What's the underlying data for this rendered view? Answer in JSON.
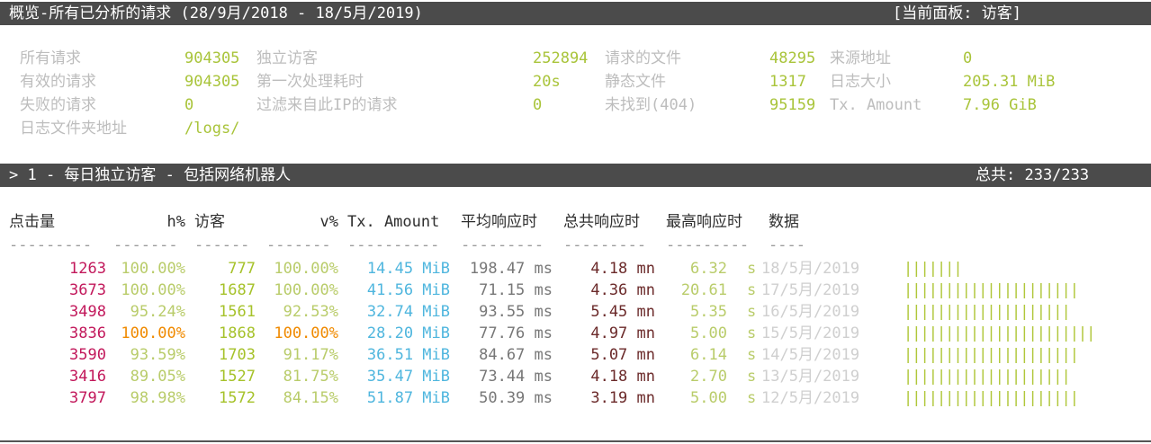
{
  "header": {
    "title": "概览-所有已分析的请求 (28/9月/2018 - 18/5月/2019)",
    "panel_label": "[当前面板: 访客]"
  },
  "overview": {
    "col1": [
      {
        "label": "所有请求",
        "value": "904305"
      },
      {
        "label": "有效的请求",
        "value": "904305"
      },
      {
        "label": "失败的请求",
        "value": "0"
      },
      {
        "label": "日志文件夹地址",
        "value": "/logs/"
      }
    ],
    "col2": [
      {
        "label": "独立访客",
        "value": "252894"
      },
      {
        "label": "第一次处理耗时",
        "value": "20s"
      },
      {
        "label": "过滤来自此IP的请求",
        "value": "0"
      }
    ],
    "col3": [
      {
        "label": "请求的文件",
        "value": "48295"
      },
      {
        "label": "静态文件",
        "value": "1317"
      },
      {
        "label": "未找到(404)",
        "value": "95159"
      }
    ],
    "col4": [
      {
        "label": "来源地址",
        "value": "0"
      },
      {
        "label": "日志大小",
        "value": "205.31 MiB"
      },
      {
        "label": "Tx. Amount",
        "value": "7.96 GiB"
      }
    ]
  },
  "panel": {
    "title": "> 1 - 每日独立访客 - 包括网络机器人",
    "total": "总共: 233/233"
  },
  "table": {
    "columns": [
      "点击量",
      "h%",
      "访客",
      "v%",
      "Tx. Amount",
      "平均响应时",
      "总共响应时",
      "最高响应时",
      "数据"
    ],
    "dashes": [
      "---------",
      "-------",
      "------",
      "-------",
      "----------",
      "---------",
      "---------",
      "---------",
      "----"
    ],
    "rows": [
      {
        "hits": "1263",
        "hp": "100.00%",
        "visitors": "777",
        "vp": "100.00%",
        "tx": "14.45 MiB",
        "avg": "198.47 ms",
        "cum": "4.18 mn",
        "max": "6.32",
        "maxu": "s",
        "date": "18/5月/2019",
        "bars": 7,
        "highlight": false
      },
      {
        "hits": "3673",
        "hp": "100.00%",
        "visitors": "1687",
        "vp": "100.00%",
        "tx": "41.56 MiB",
        "avg": "71.15 ms",
        "cum": "4.36 mn",
        "max": "20.61",
        "maxu": "s",
        "date": "17/5月/2019",
        "bars": 21,
        "highlight": false
      },
      {
        "hits": "3498",
        "hp": "95.24%",
        "visitors": "1561",
        "vp": "92.53%",
        "tx": "32.74 MiB",
        "avg": "93.55 ms",
        "cum": "5.45 mn",
        "max": "5.35",
        "maxu": "s",
        "date": "16/5月/2019",
        "bars": 20,
        "highlight": false
      },
      {
        "hits": "3836",
        "hp": "100.00%",
        "visitors": "1868",
        "vp": "100.00%",
        "tx": "28.20 MiB",
        "avg": "77.76 ms",
        "cum": "4.97 mn",
        "max": "5.00",
        "maxu": "s",
        "date": "15/5月/2019",
        "bars": 23,
        "highlight": true
      },
      {
        "hits": "3590",
        "hp": "93.59%",
        "visitors": "1703",
        "vp": "91.17%",
        "tx": "36.51 MiB",
        "avg": "84.67 ms",
        "cum": "5.07 mn",
        "max": "6.14",
        "maxu": "s",
        "date": "14/5月/2019",
        "bars": 21,
        "highlight": false
      },
      {
        "hits": "3416",
        "hp": "89.05%",
        "visitors": "1527",
        "vp": "81.75%",
        "tx": "35.47 MiB",
        "avg": "73.44 ms",
        "cum": "4.18 mn",
        "max": "2.70",
        "maxu": "s",
        "date": "13/5月/2019",
        "bars": 20,
        "highlight": false
      },
      {
        "hits": "3797",
        "hp": "98.98%",
        "visitors": "1572",
        "vp": "84.15%",
        "tx": "51.87 MiB",
        "avg": "50.39 ms",
        "cum": "3.19 mn",
        "max": "5.00",
        "maxu": "s",
        "date": "12/5月/2019",
        "bars": 21,
        "highlight": false
      }
    ]
  },
  "colors": {
    "bar_bg": "#4b4b4b",
    "green": "#a9c43a",
    "hits": "#c2185b",
    "tx": "#4fb6de",
    "highlight": "#f08a00"
  }
}
